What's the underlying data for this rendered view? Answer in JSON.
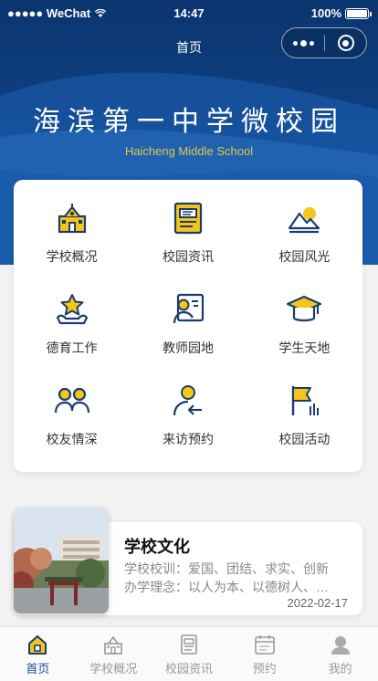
{
  "status_bar": {
    "carrier": "●●●●● WeChat",
    "time": "14:47",
    "battery": "100%"
  },
  "nav": {
    "title": "首页"
  },
  "hero": {
    "school_name": "海滨第一中学微校园",
    "school_name_en": "Haicheng Middle School"
  },
  "menu": {
    "items": [
      {
        "label": "学校概况",
        "icon": "school-building-icon"
      },
      {
        "label": "校园资讯",
        "icon": "newspaper-icon"
      },
      {
        "label": "校园风光",
        "icon": "landscape-icon"
      },
      {
        "label": "德育工作",
        "icon": "star-hand-icon"
      },
      {
        "label": "教师园地",
        "icon": "teacher-board-icon"
      },
      {
        "label": "学生天地",
        "icon": "graduation-cap-icon"
      },
      {
        "label": "校友情深",
        "icon": "alumni-icon"
      },
      {
        "label": "来访预约",
        "icon": "visitor-icon"
      },
      {
        "label": "校园活动",
        "icon": "flag-icon"
      }
    ]
  },
  "article": {
    "title": "学校文化",
    "motto": "学校校训：爱国、团结、求实、创新",
    "philosophy": "办学理念：以人为本、以德树人、…",
    "date": "2022-02-17"
  },
  "tabbar": {
    "items": [
      {
        "label": "首页",
        "icon": "home-icon",
        "active": true
      },
      {
        "label": "学校概况",
        "icon": "school-building-icon",
        "active": false
      },
      {
        "label": "校园资讯",
        "icon": "newspaper-icon",
        "active": false
      },
      {
        "label": "预约",
        "icon": "calendar-icon",
        "active": false
      },
      {
        "label": "我的",
        "icon": "user-icon",
        "active": false
      }
    ]
  },
  "colors": {
    "primary": "#1a4e96",
    "accent": "#f5c518",
    "hero_dark": "#0d3a7a"
  }
}
